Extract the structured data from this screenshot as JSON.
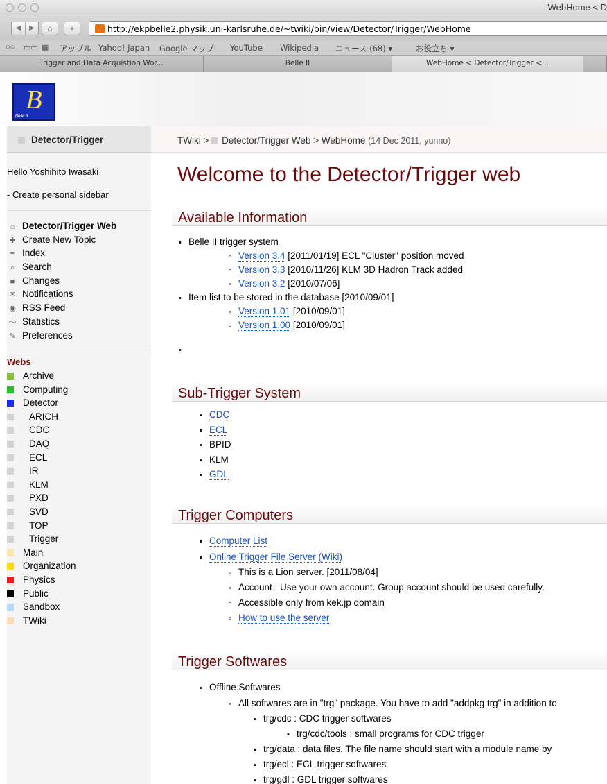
{
  "browser": {
    "window_title": "WebHome < D",
    "url": "http://ekpbelle2.physik.uni-karlsruhe.de/~twiki/bin/view/Detector/Trigger/WebHome",
    "bookmarks": [
      "アップル",
      "Yahoo! Japan",
      "Google マップ",
      "YouTube",
      "Wikipedia",
      "ニュース (68) ▾",
      "お役立ち ▾"
    ],
    "tabs": [
      "Trigger and Data Acquistion Wor...",
      "Belle II",
      "WebHome < Detector/Trigger <..."
    ]
  },
  "logo": {
    "letter": "B",
    "caption": "Belle II"
  },
  "sidebar": {
    "title": "Detector/Trigger",
    "hello_prefix": "Hello ",
    "user": "Yoshihito Iwasaki",
    "create_sidebar": "- Create personal sidebar",
    "menu": [
      {
        "label": "Detector/Trigger Web",
        "icon": "home-icon",
        "glyph": "⌂",
        "bold": true
      },
      {
        "label": "Create New Topic",
        "icon": "new-topic-icon",
        "glyph": "✚"
      },
      {
        "label": "Index",
        "icon": "index-icon",
        "glyph": "≡"
      },
      {
        "label": "Search",
        "icon": "search-icon",
        "glyph": "⌕"
      },
      {
        "label": "Changes",
        "icon": "changes-icon",
        "glyph": "■"
      },
      {
        "label": "Notifications",
        "icon": "notifications-icon",
        "glyph": "✉"
      },
      {
        "label": "RSS Feed",
        "icon": "rss-icon",
        "glyph": "◉"
      },
      {
        "label": "Statistics",
        "icon": "statistics-icon",
        "glyph": "〜"
      },
      {
        "label": "Preferences",
        "icon": "preferences-icon",
        "glyph": "✎"
      }
    ],
    "webs_heading": "Webs",
    "webs": [
      {
        "label": "Archive",
        "color": "#88c03c",
        "sub": false
      },
      {
        "label": "Computing",
        "color": "#22c028",
        "sub": false
      },
      {
        "label": "Detector",
        "color": "#1a2aee",
        "sub": false
      },
      {
        "label": "ARICH",
        "color": "#d4d4d4",
        "sub": true
      },
      {
        "label": "CDC",
        "color": "#d4d4d4",
        "sub": true
      },
      {
        "label": "DAQ",
        "color": "#d4d4d4",
        "sub": true
      },
      {
        "label": "ECL",
        "color": "#d4d4d4",
        "sub": true
      },
      {
        "label": "IR",
        "color": "#d4d4d4",
        "sub": true
      },
      {
        "label": "KLM",
        "color": "#d4d4d4",
        "sub": true
      },
      {
        "label": "PXD",
        "color": "#d4d4d4",
        "sub": true
      },
      {
        "label": "SVD",
        "color": "#d4d4d4",
        "sub": true
      },
      {
        "label": "TOP",
        "color": "#d4d4d4",
        "sub": true
      },
      {
        "label": "Trigger",
        "color": "#d4d4d4",
        "sub": true
      },
      {
        "label": "Main",
        "color": "#fbe8a6",
        "sub": false
      },
      {
        "label": "Organization",
        "color": "#f8e000",
        "sub": false
      },
      {
        "label": "Physics",
        "color": "#ee1a1a",
        "sub": false
      },
      {
        "label": "Public",
        "color": "#000000",
        "sub": false
      },
      {
        "label": "Sandbox",
        "color": "#b8d8f4",
        "sub": false
      },
      {
        "label": "TWiki",
        "color": "#fcdcb8",
        "sub": false
      }
    ]
  },
  "breadcrumb": {
    "root": "TWiki",
    "sep": " > ",
    "web": "Detector/Trigger Web",
    "topic": "WebHome",
    "date": "(14 Dec 2011, yunno)"
  },
  "main": {
    "title": "Welcome to the Detector/Trigger web",
    "h_available": "Available Information",
    "belle_trigger": "Belle II trigger system",
    "versions": [
      {
        "link": "Version 3.4",
        "text": " [2011/01/19] ECL \"Cluster\" position moved"
      },
      {
        "link": "Version 3.3",
        "text": " [2010/11/26] KLM 3D Hadron Track added"
      },
      {
        "link": "Version 3.2",
        "text": " [2010/07/06]"
      }
    ],
    "item_list": "Item list to be stored in the database [2010/09/01]",
    "item_versions": [
      {
        "link": "Version 1.01",
        "text": " [2010/09/01]"
      },
      {
        "link": "Version 1.00",
        "text": " [2010/09/01]"
      }
    ],
    "h_sub": "Sub-Trigger System",
    "sub": [
      {
        "label": "CDC",
        "link": true
      },
      {
        "label": "ECL",
        "link": true
      },
      {
        "label": "BPID",
        "link": false
      },
      {
        "label": "KLM",
        "link": false
      },
      {
        "label": "GDL",
        "link": true
      }
    ],
    "h_computers": "Trigger Computers",
    "computer_list": "Computer List",
    "file_server": "Online Trigger File Server (Wiki)",
    "server_notes": [
      "This is a Lion server. [2011/08/04]",
      "Account : Use your own account. Group account should be used carefully.",
      "Accessible only from kek.jp domain"
    ],
    "how_to": "How to use the server",
    "h_softwares": "Trigger Softwares",
    "offline": "Offline Softwares",
    "all_softwares": "All softwares are in \"trg\" package. You have to add \"addpkg trg\" in addition to",
    "sw": [
      "trg/cdc : CDC trigger softwares",
      "trg/cdc/tools : small programs for CDC trigger",
      "trg/data : data files. The file name should start with a module name by",
      "trg/ecl : ECL trigger softwares",
      "trg/gdl : GDL trigger softwares"
    ]
  }
}
